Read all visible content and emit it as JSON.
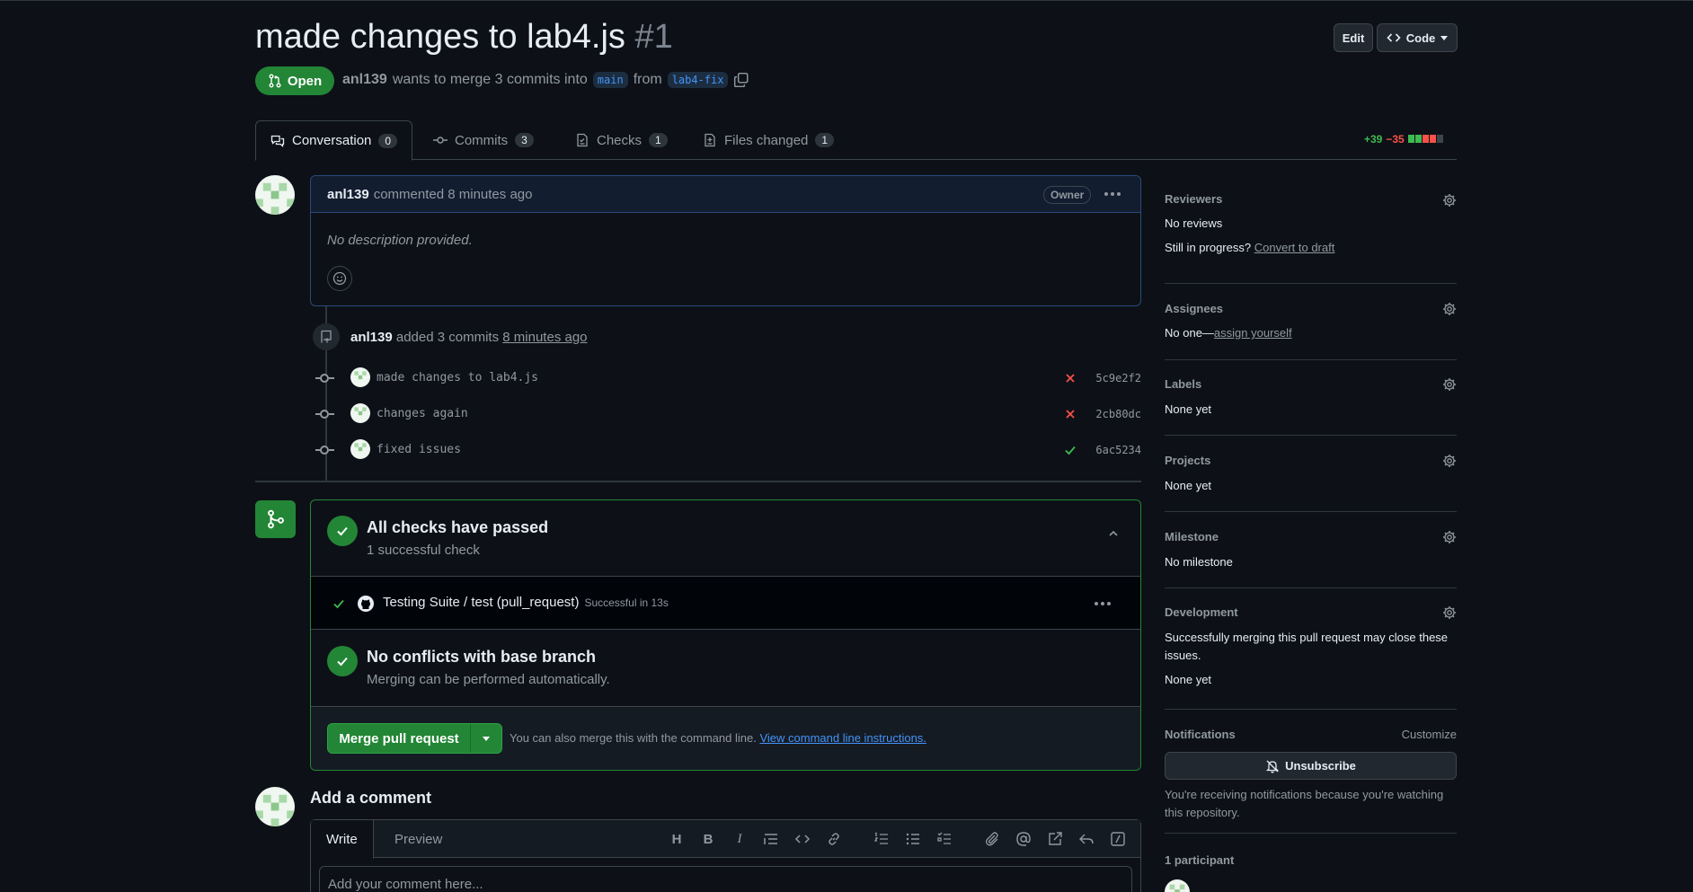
{
  "pr": {
    "title": "made changes to lab4.js",
    "number": "#1",
    "state": "Open",
    "author": "anl139",
    "merge_text_1": "wants to merge 3 commits into",
    "base_branch": "main",
    "merge_text_2": "from",
    "head_branch": "lab4-fix"
  },
  "header_buttons": {
    "edit": "Edit",
    "code": "Code"
  },
  "tabs": [
    {
      "label": "Conversation",
      "count": "0"
    },
    {
      "label": "Commits",
      "count": "3"
    },
    {
      "label": "Checks",
      "count": "1"
    },
    {
      "label": "Files changed",
      "count": "1"
    }
  ],
  "diffstat": {
    "additions": "+39",
    "deletions": "−35"
  },
  "comment": {
    "author": "anl139",
    "action": "commented 8 minutes ago",
    "badge": "Owner",
    "body": "No description provided."
  },
  "commit_event": {
    "author": "anl139",
    "text": "added 3 commits",
    "time": "8 minutes ago"
  },
  "commits": [
    {
      "message": "made changes to lab4.js",
      "sha": "5c9e2f2",
      "status": "fail"
    },
    {
      "message": "changes again",
      "sha": "2cb80dc",
      "status": "fail"
    },
    {
      "message": "fixed issues",
      "sha": "6ac5234",
      "status": "pass"
    }
  ],
  "merge_box": {
    "checks_title": "All checks have passed",
    "checks_sub": "1 successful check",
    "check_name": "Testing Suite / test (pull_request)",
    "check_time": "Successful in 13s",
    "conflict_title": "No conflicts with base branch",
    "conflict_sub": "Merging can be performed automatically.",
    "merge_button": "Merge pull request",
    "hint": "You can also merge this with the command line.",
    "hint_link": "View command line instructions."
  },
  "add_comment": {
    "title": "Add a comment",
    "tab_write": "Write",
    "tab_preview": "Preview",
    "placeholder": "Add your comment here..."
  },
  "sidebar": {
    "reviewers": {
      "title": "Reviewers",
      "value": "No reviews",
      "draft_prefix": "Still in progress?",
      "draft_link": "Convert to draft"
    },
    "assignees": {
      "title": "Assignees",
      "value": "No one—",
      "link": "assign yourself"
    },
    "labels": {
      "title": "Labels",
      "value": "None yet"
    },
    "projects": {
      "title": "Projects",
      "value": "None yet"
    },
    "milestone": {
      "title": "Milestone",
      "value": "No milestone"
    },
    "development": {
      "title": "Development",
      "desc": "Successfully merging this pull request may close these issues.",
      "value": "None yet"
    },
    "notifications": {
      "title": "Notifications",
      "customize": "Customize",
      "button": "Unsubscribe",
      "note": "You're receiving notifications because you're watching this repository."
    },
    "participants": {
      "title": "1 participant"
    }
  },
  "colors": {
    "green": "#238636",
    "red": "#f85149",
    "blue": "#4493f8",
    "bg": "#0d1117"
  }
}
